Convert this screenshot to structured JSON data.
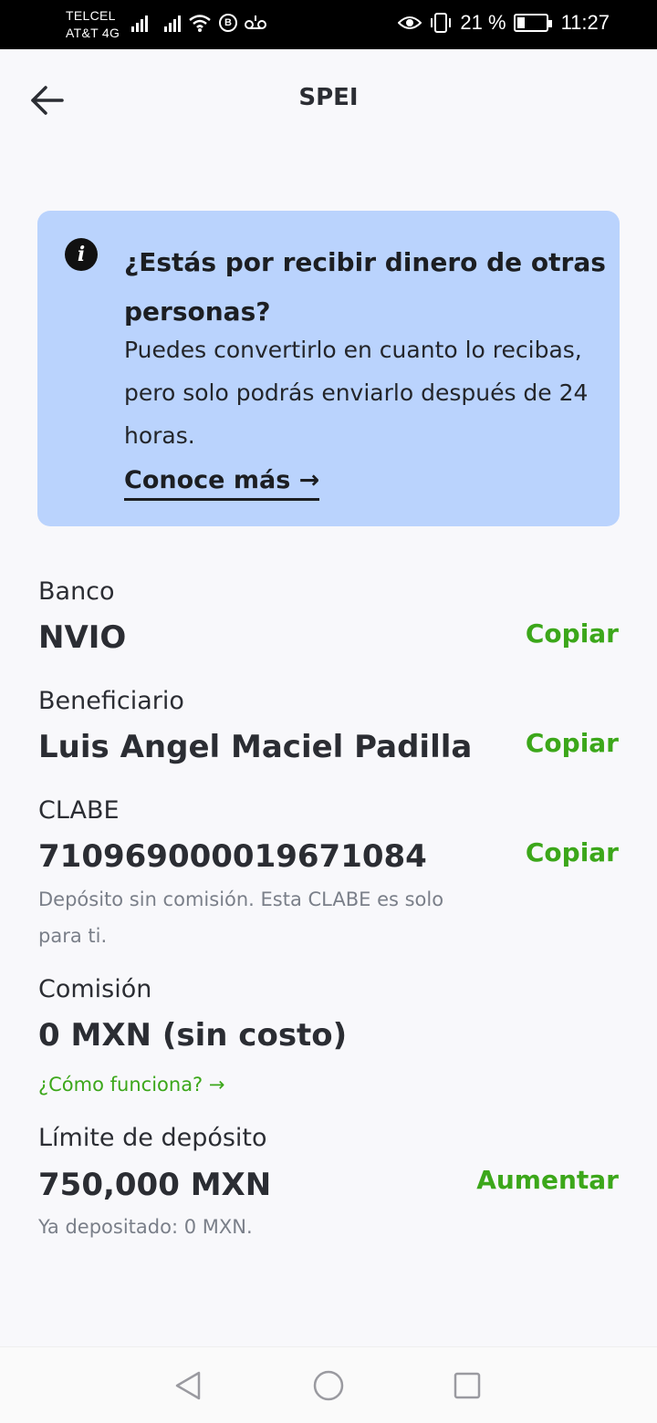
{
  "status_bar": {
    "carrier_1": "TELCEL",
    "carrier_2": "AT&T 4G",
    "battery": "21 %",
    "time": "11:27",
    "icons": [
      "signal-icon",
      "signal-icon",
      "wifi-icon",
      "b-circle-icon",
      "voicemail-icon",
      "eye-icon",
      "vibrate-icon",
      "battery-charging-icon"
    ]
  },
  "header": {
    "title": "SPEI",
    "back_icon": "arrow-left-icon"
  },
  "info_card": {
    "icon": "info-icon",
    "title": "¿Estás por recibir dinero de otras personas?",
    "body": "Puedes convertirlo en cuanto lo recibas, pero solo podrás enviarlo después de 24 horas.",
    "link": "Conoce más →",
    "background": "#bad3fd"
  },
  "details": {
    "bank": {
      "label": "Banco",
      "value": "NVIO",
      "action": "Copiar"
    },
    "beneficiary": {
      "label": "Beneficiario",
      "value": "Luis Angel Maciel Padilla",
      "action": "Copiar"
    },
    "clabe": {
      "label": "CLABE",
      "value": "710969000019671084",
      "action": "Copiar",
      "note": "Depósito sin comisión. Esta CLABE es solo para ti."
    },
    "commission": {
      "label": "Comisión",
      "value": "0 MXN (sin costo)",
      "link": "¿Cómo funciona? →"
    },
    "limit": {
      "label": "Límite de depósito",
      "value": "750,000 MXN",
      "action": "Aumentar",
      "note": "Ya depositado: 0 MXN."
    }
  },
  "colors": {
    "accent_green": "#3ca71a",
    "background": "#f8f8fb",
    "text": "#2b2d33",
    "muted": "#7a7f89"
  },
  "nav_bar": {
    "icons": [
      "back-triangle-icon",
      "home-circle-icon",
      "recents-square-icon"
    ]
  }
}
